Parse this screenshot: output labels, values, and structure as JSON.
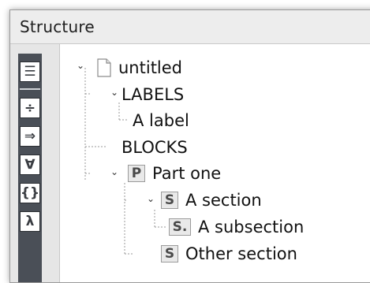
{
  "panel": {
    "title": "Structure"
  },
  "toolbar": {
    "buttons": [
      {
        "name": "outline-view-button",
        "glyph": "☰"
      },
      {
        "name": "divide-button",
        "glyph": "÷"
      },
      {
        "name": "implies-button",
        "glyph": "⇒"
      },
      {
        "name": "forall-button",
        "glyph": "∀"
      },
      {
        "name": "braces-button",
        "glyph": "{}"
      },
      {
        "name": "lambda-button",
        "glyph": "λ"
      }
    ]
  },
  "tree": {
    "root": {
      "label": "untitled",
      "icon": "document-icon"
    },
    "labels": {
      "label": "LABELS"
    },
    "a_label": {
      "label": "A label"
    },
    "blocks": {
      "label": "BLOCKS"
    },
    "part_one": {
      "label": "Part one",
      "badge": "P"
    },
    "a_section": {
      "label": "A section",
      "badge": "S"
    },
    "a_subsection": {
      "label": "A subsection",
      "badge": "S."
    },
    "other_section": {
      "label": "Other section",
      "badge": "S"
    }
  }
}
